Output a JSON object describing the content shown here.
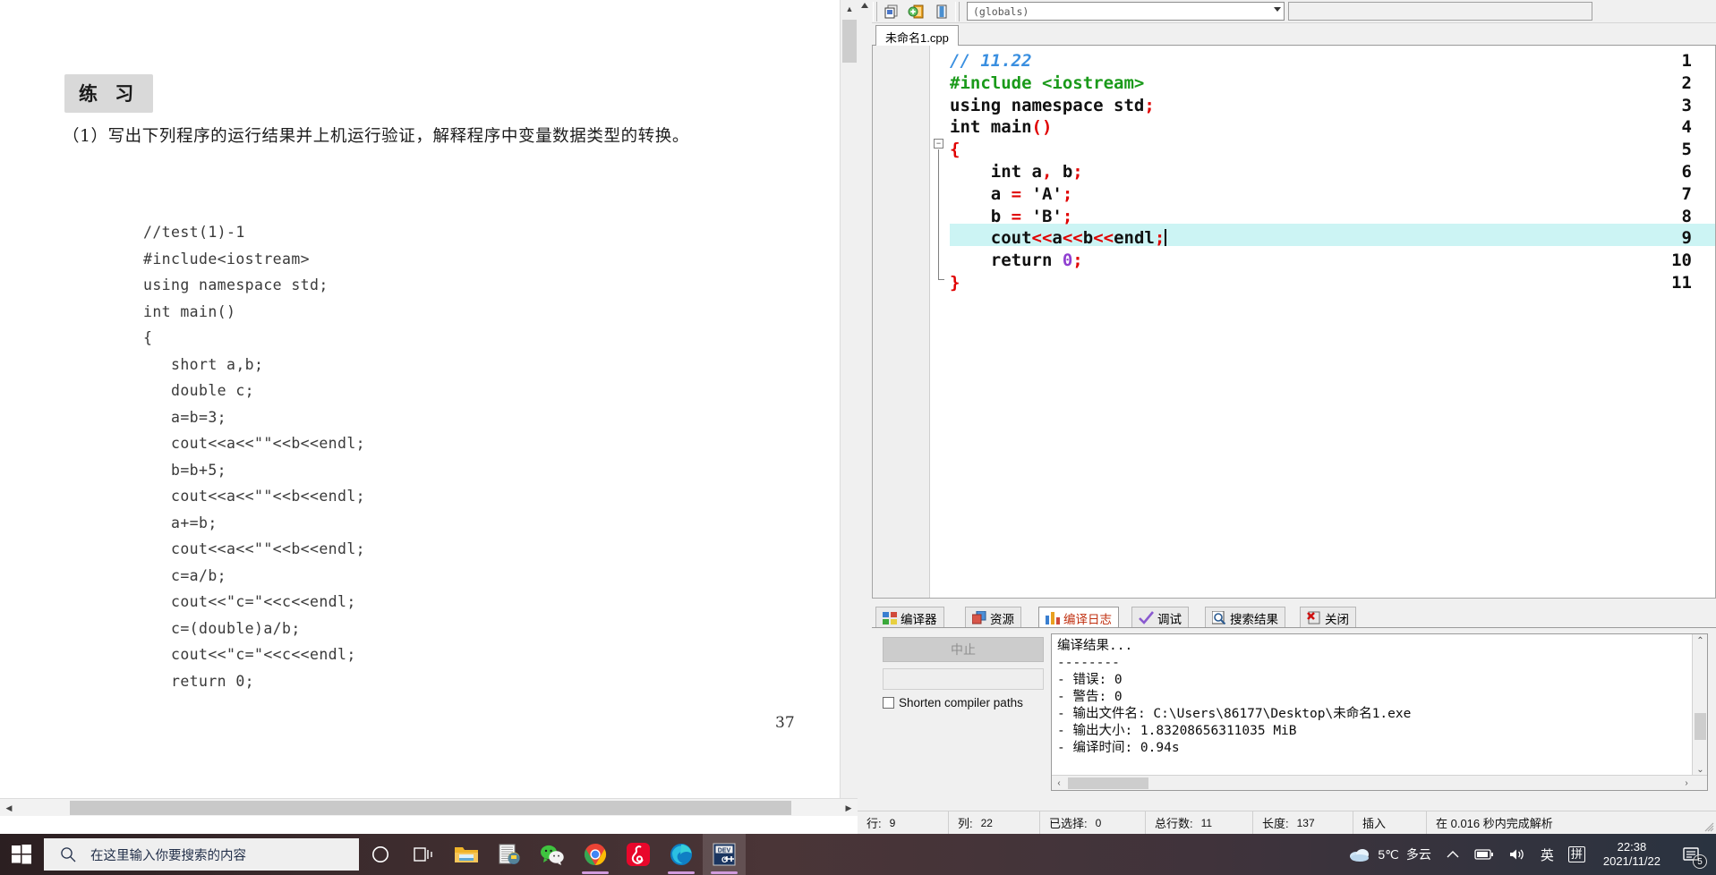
{
  "document": {
    "headline": "练 习",
    "paragraph": "（1）写出下列程序的运行结果并上机运行验证，解释程序中变量数据类型的转换。",
    "code": "//test(1)-1\n#include<iostream>\nusing namespace std;\nint main()\n{\n   short a,b;\n   double c;\n   a=b=3;\n   cout<<a<<\"\"<<b<<endl;\n   b=b+5;\n   cout<<a<<\"\"<<b<<endl;\n   a+=b;\n   cout<<a<<\"\"<<b<<endl;\n   c=a/b;\n   cout<<\"c=\"<<c<<endl;\n   c=(double)a/b;\n   cout<<\"c=\"<<c<<endl;\n   return 0;",
    "page_number": "37"
  },
  "ide": {
    "scope_combo": "(globals)",
    "scope_combo_placeholder": "(globals)",
    "blank_combo": "",
    "tab_filename": "未命名1.cpp",
    "editor": {
      "lines": [
        {
          "no": "1",
          "text": "// 11.22"
        },
        {
          "no": "2",
          "text": "#include <iostream>"
        },
        {
          "no": "3",
          "text": "using namespace std;"
        },
        {
          "no": "4",
          "text": "int main()"
        },
        {
          "no": "5",
          "text": "{"
        },
        {
          "no": "6",
          "text": "    int a, b;"
        },
        {
          "no": "7",
          "text": "    a = 'A';"
        },
        {
          "no": "8",
          "text": "    b = 'B';"
        },
        {
          "no": "9",
          "text": "    cout<<a<<b<<endl;"
        },
        {
          "no": "10",
          "text": "    return 0;"
        },
        {
          "no": "11",
          "text": "}"
        }
      ],
      "active_line": "9"
    },
    "message_tabs": [
      {
        "label": "编译器",
        "icon": "compiler-icon",
        "active": false
      },
      {
        "label": "资源",
        "icon": "resource-icon",
        "active": false
      },
      {
        "label": "编译日志",
        "icon": "compile-log-icon",
        "active": true
      },
      {
        "label": "调试",
        "icon": "debug-check-icon",
        "active": false
      },
      {
        "label": "搜索结果",
        "icon": "search-results-icon",
        "active": false
      },
      {
        "label": "关闭",
        "icon": "close-icon",
        "active": false
      }
    ],
    "abort_button": "中止",
    "shorten_checkbox_label": "Shorten compiler paths",
    "compile_log": "编译结果...\n--------\n- 错误: 0\n- 警告: 0\n- 输出文件名: C:\\Users\\86177\\Desktop\\未命名1.exe\n- 输出大小: 1.83208656311035 MiB\n- 编译时间: 0.94s",
    "status_bar": [
      {
        "label": "行:",
        "value": "9"
      },
      {
        "label": "列:",
        "value": "22"
      },
      {
        "label": "已选择:",
        "value": "0"
      },
      {
        "label": "总行数:",
        "value": "11"
      },
      {
        "label": "长度:",
        "value": "137"
      },
      {
        "label": "插入",
        "value": ""
      },
      {
        "label": "在 0.016 秒内完成解析",
        "value": ""
      }
    ]
  },
  "taskbar": {
    "search_placeholder": "在这里输入你要搜索的内容",
    "apps": [
      {
        "name": "cortana-icon"
      },
      {
        "name": "task-view-icon"
      },
      {
        "name": "file-explorer-icon"
      },
      {
        "name": "notepad-python-icon"
      },
      {
        "name": "wechat-icon"
      },
      {
        "name": "chrome-icon"
      },
      {
        "name": "netease-music-icon"
      },
      {
        "name": "edge-icon"
      },
      {
        "name": "devcpp-icon"
      }
    ],
    "weather_temp": "5℃",
    "weather_desc": "多云",
    "ime_lang": "英",
    "ime_mode": "拼",
    "time": "22:38",
    "date": "2021/11/22",
    "notification_count": "5"
  },
  "colors": {
    "highlight_line": "#ccf4f4",
    "comment": "#3a8fe0",
    "preprocessor": "#1a9a1a",
    "symbol": "#e00000",
    "number": "#8f3fd0",
    "active_tab_text": "#c03010"
  }
}
